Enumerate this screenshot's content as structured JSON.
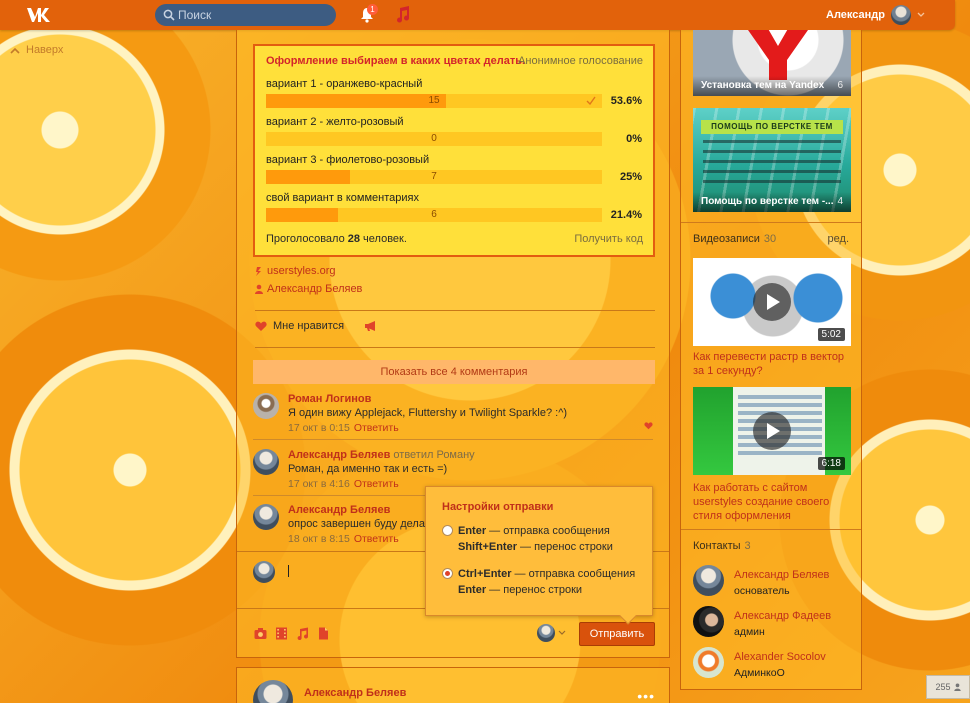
{
  "header": {
    "search_placeholder": "Поиск",
    "notifications_count": "1",
    "user_name": "Александр"
  },
  "nav": {
    "up_label": "Наверх"
  },
  "poll": {
    "title": "Оформление выбираем в каких цветах делать.",
    "type_label": "Анонимное голосование",
    "options": [
      {
        "label": "вариант 1 - оранжево-красный",
        "count": "15",
        "percent": "53.6%",
        "share": 0.536,
        "voted": true
      },
      {
        "label": "вариант 2 - желто-розовый",
        "count": "0",
        "percent": "0%",
        "share": 0.0,
        "voted": false
      },
      {
        "label": "вариант 3 - фиолетово-розовый",
        "count": "7",
        "percent": "25%",
        "share": 0.25,
        "voted": false
      },
      {
        "label": "свой вариант в комментариях",
        "count": "6",
        "percent": "21.4%",
        "share": 0.214,
        "voted": false
      }
    ],
    "voted_prefix": "Проголосовало ",
    "voted_count": "28",
    "voted_suffix": " человек.",
    "get_code": "Получить код"
  },
  "post": {
    "source_link": "userstyles.org",
    "author_link": "Александр Беляев",
    "like_label": "Мне нравится",
    "show_all_comments": "Показать все 4 комментария"
  },
  "comments": [
    {
      "author": "Роман Логинов",
      "reply_to": "",
      "text": "Я один вижу Applejack, Fluttershy и Twilight Sparkle? :^)",
      "date": "17 окт в 0:15",
      "reply_label": "Ответить"
    },
    {
      "author": "Александр Беляев",
      "reply_to": " ответил Роману",
      "text": "Роман, да именно так и есть =)",
      "date": "17 окт в 4:16",
      "reply_label": "Ответить"
    },
    {
      "author": "Александр Беляев",
      "reply_to": "",
      "text": "опрос завершен буду делать",
      "date": "18 окт в 8:15",
      "reply_label": "Ответить"
    }
  ],
  "composer": {
    "send_label": "Отправить"
  },
  "send_settings": {
    "title": "Настройки отправки",
    "option_1_line_1_key": "Enter",
    "option_1_line_1_text": " — отправка сообщения",
    "option_1_line_2_key": "Shift+Enter",
    "option_1_line_2_text": " — перенос строки",
    "option_2_line_1_key": "Ctrl+Enter",
    "option_2_line_1_text": " — отправка сообщения",
    "option_2_line_2_key": "Enter",
    "option_2_line_2_text": " — перенос строки",
    "selected": 2
  },
  "next_post": {
    "author": "Александр Беляев"
  },
  "sidebar": {
    "themes": [
      {
        "title": "Установка тем на Yandex",
        "count": "6"
      },
      {
        "banner": "ПОМОЩЬ ПО ВЕРСТКЕ ТЕМ",
        "title": "Помощь по верстке тем -...",
        "count": "4"
      }
    ],
    "videos_label": "Видеозаписи",
    "videos_count": "30",
    "videos_edit": "ред.",
    "videos": [
      {
        "title": "Как перевести растр в вектор за 1 секунду?",
        "duration": "5:02"
      },
      {
        "title": "Как работать с сайтом userstyles создание своего стиля оформления",
        "duration": "6:18"
      }
    ],
    "contacts_label": "Контакты",
    "contacts_count": "3",
    "contacts": [
      {
        "name": "Александр Беляев",
        "role": "основатель"
      },
      {
        "name": "Александр Фадеев",
        "role": "админ"
      },
      {
        "name": "Alexander Socolov",
        "role": "АдминкоО"
      }
    ]
  },
  "online_counter": "255",
  "colors": {
    "header": "#e2620b",
    "accent_red": "#c0301a",
    "poll_bg": "#ffe03a",
    "bar_fill": "#ff9a0c",
    "send_button": "#d9520c"
  }
}
